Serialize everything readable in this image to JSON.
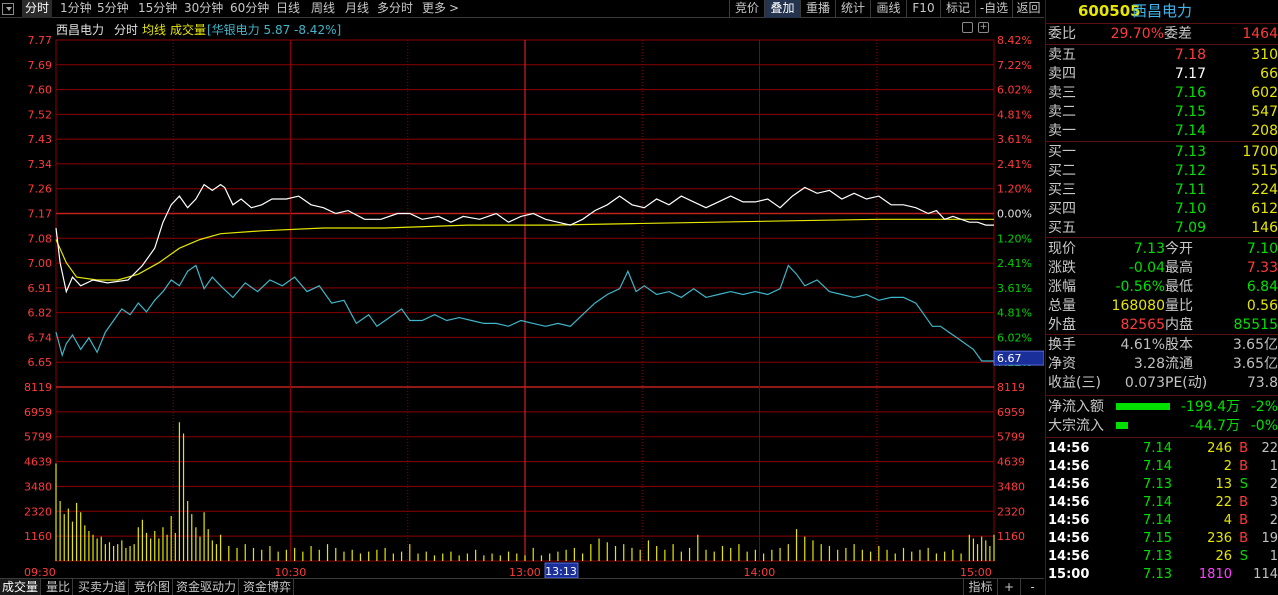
{
  "toolbar": {
    "left_items": [
      "分时",
      "1分钟",
      "5分钟",
      "15分钟",
      "30分钟",
      "60分钟",
      "日线",
      "周线",
      "月线",
      "多分时",
      "更多"
    ],
    "active": "分时",
    "right_items": [
      "竞价",
      "叠加",
      "重播",
      "统计",
      "画线",
      "F10",
      "标记",
      "-自选",
      "返回"
    ],
    "highlight": "叠加"
  },
  "chart_header": {
    "stock_name": "西昌电力",
    "label_fenshi": "分时",
    "label_junxian": "均线",
    "label_volume": "成交量",
    "overlay": "[华银电力 5.87 -8.42%]"
  },
  "price_axis": {
    "left": [
      "7.77",
      "7.69",
      "7.60",
      "7.52",
      "7.43",
      "7.34",
      "7.26",
      "7.17",
      "7.08",
      "7.00",
      "6.91",
      "6.82",
      "6.74",
      "6.65"
    ],
    "right": [
      "8.42%",
      "7.22%",
      "6.02%",
      "4.81%",
      "3.61%",
      "2.41%",
      "1.20%",
      "0.00%",
      "1.20%",
      "2.41%",
      "3.61%",
      "4.81%",
      "6.02%",
      "7.22%"
    ],
    "cursor_value": "6.67"
  },
  "volume_axis": {
    "labels": [
      "8119",
      "6959",
      "5799",
      "4639",
      "3480",
      "2320",
      "1160"
    ]
  },
  "time_axis": {
    "labels": [
      "09:30",
      "10:30",
      "13:00",
      "14:00",
      "15:00"
    ],
    "cursor_time": "13:13"
  },
  "colors": {
    "grid": "#8b0000",
    "price_line": "#ffffff",
    "avg_line": "#e6e600",
    "overlay_line": "#3fb6c9",
    "volume_bar": "#e6e600",
    "axis_text": "#ff3b3b"
  },
  "series": {
    "price": [
      [
        0,
        7.12
      ],
      [
        2,
        7.0
      ],
      [
        5,
        6.9
      ],
      [
        8,
        6.95
      ],
      [
        12,
        6.92
      ],
      [
        18,
        6.94
      ],
      [
        25,
        6.93
      ],
      [
        35,
        6.94
      ],
      [
        42,
        6.99
      ],
      [
        48,
        7.05
      ],
      [
        52,
        7.14
      ],
      [
        56,
        7.2
      ],
      [
        60,
        7.23
      ],
      [
        64,
        7.19
      ],
      [
        68,
        7.22
      ],
      [
        72,
        7.27
      ],
      [
        76,
        7.25
      ],
      [
        80,
        7.27
      ],
      [
        82,
        7.26
      ],
      [
        86,
        7.2
      ],
      [
        90,
        7.22
      ],
      [
        95,
        7.19
      ],
      [
        100,
        7.2
      ],
      [
        105,
        7.22
      ],
      [
        112,
        7.22
      ],
      [
        118,
        7.23
      ],
      [
        124,
        7.2
      ],
      [
        130,
        7.19
      ],
      [
        136,
        7.17
      ],
      [
        142,
        7.18
      ],
      [
        150,
        7.15
      ],
      [
        158,
        7.15
      ],
      [
        166,
        7.17
      ],
      [
        172,
        7.17
      ],
      [
        178,
        7.15
      ],
      [
        186,
        7.16
      ],
      [
        192,
        7.14
      ],
      [
        198,
        7.16
      ],
      [
        206,
        7.15
      ],
      [
        214,
        7.17
      ],
      [
        220,
        7.14
      ],
      [
        226,
        7.16
      ],
      [
        232,
        7.17
      ],
      [
        238,
        7.15
      ],
      [
        244,
        7.14
      ],
      [
        250,
        7.13
      ],
      [
        256,
        7.15
      ],
      [
        262,
        7.18
      ],
      [
        268,
        7.2
      ],
      [
        274,
        7.23
      ],
      [
        280,
        7.2
      ],
      [
        286,
        7.19
      ],
      [
        292,
        7.22
      ],
      [
        298,
        7.2
      ],
      [
        304,
        7.23
      ],
      [
        310,
        7.21
      ],
      [
        316,
        7.19
      ],
      [
        322,
        7.21
      ],
      [
        328,
        7.23
      ],
      [
        334,
        7.21
      ],
      [
        340,
        7.21
      ],
      [
        346,
        7.22
      ],
      [
        352,
        7.19
      ],
      [
        358,
        7.23
      ],
      [
        364,
        7.26
      ],
      [
        370,
        7.24
      ],
      [
        376,
        7.25
      ],
      [
        382,
        7.22
      ],
      [
        388,
        7.24
      ],
      [
        394,
        7.22
      ],
      [
        400,
        7.23
      ],
      [
        406,
        7.2
      ],
      [
        412,
        7.2
      ],
      [
        418,
        7.19
      ],
      [
        424,
        7.17
      ],
      [
        428,
        7.18
      ],
      [
        432,
        7.15
      ],
      [
        436,
        7.16
      ],
      [
        440,
        7.15
      ],
      [
        444,
        7.14
      ],
      [
        448,
        7.14
      ],
      [
        452,
        7.13
      ],
      [
        456,
        7.13
      ]
    ],
    "avg": [
      [
        0,
        7.08
      ],
      [
        5,
        7.0
      ],
      [
        10,
        6.95
      ],
      [
        20,
        6.94
      ],
      [
        30,
        6.94
      ],
      [
        40,
        6.96
      ],
      [
        50,
        7.0
      ],
      [
        60,
        7.05
      ],
      [
        70,
        7.08
      ],
      [
        80,
        7.1
      ],
      [
        100,
        7.11
      ],
      [
        130,
        7.12
      ],
      [
        160,
        7.12
      ],
      [
        200,
        7.13
      ],
      [
        240,
        7.13
      ],
      [
        280,
        7.135
      ],
      [
        320,
        7.14
      ],
      [
        360,
        7.145
      ],
      [
        400,
        7.15
      ],
      [
        440,
        7.15
      ],
      [
        456,
        7.15
      ]
    ],
    "overlay": [
      [
        0,
        6.76
      ],
      [
        3,
        6.68
      ],
      [
        5,
        6.72
      ],
      [
        8,
        6.75
      ],
      [
        12,
        6.7
      ],
      [
        16,
        6.74
      ],
      [
        20,
        6.69
      ],
      [
        24,
        6.76
      ],
      [
        28,
        6.8
      ],
      [
        32,
        6.84
      ],
      [
        36,
        6.82
      ],
      [
        40,
        6.86
      ],
      [
        44,
        6.83
      ],
      [
        48,
        6.87
      ],
      [
        52,
        6.9
      ],
      [
        56,
        6.94
      ],
      [
        60,
        6.92
      ],
      [
        64,
        6.97
      ],
      [
        68,
        6.99
      ],
      [
        72,
        6.91
      ],
      [
        76,
        6.95
      ],
      [
        80,
        6.92
      ],
      [
        86,
        6.88
      ],
      [
        92,
        6.93
      ],
      [
        98,
        6.9
      ],
      [
        104,
        6.94
      ],
      [
        110,
        6.92
      ],
      [
        116,
        6.95
      ],
      [
        122,
        6.9
      ],
      [
        128,
        6.92
      ],
      [
        134,
        6.86
      ],
      [
        140,
        6.87
      ],
      [
        146,
        6.79
      ],
      [
        152,
        6.82
      ],
      [
        156,
        6.78
      ],
      [
        162,
        6.81
      ],
      [
        168,
        6.84
      ],
      [
        172,
        6.8
      ],
      [
        178,
        6.8
      ],
      [
        184,
        6.82
      ],
      [
        190,
        6.8
      ],
      [
        196,
        6.81
      ],
      [
        202,
        6.8
      ],
      [
        208,
        6.79
      ],
      [
        214,
        6.79
      ],
      [
        220,
        6.78
      ],
      [
        226,
        6.8
      ],
      [
        232,
        6.79
      ],
      [
        238,
        6.78
      ],
      [
        244,
        6.79
      ],
      [
        250,
        6.78
      ],
      [
        256,
        6.82
      ],
      [
        262,
        6.86
      ],
      [
        268,
        6.89
      ],
      [
        274,
        6.91
      ],
      [
        278,
        6.97
      ],
      [
        282,
        6.9
      ],
      [
        286,
        6.92
      ],
      [
        292,
        6.89
      ],
      [
        298,
        6.9
      ],
      [
        304,
        6.88
      ],
      [
        310,
        6.91
      ],
      [
        316,
        6.88
      ],
      [
        322,
        6.89
      ],
      [
        328,
        6.9
      ],
      [
        334,
        6.89
      ],
      [
        340,
        6.9
      ],
      [
        346,
        6.89
      ],
      [
        352,
        6.91
      ],
      [
        356,
        6.99
      ],
      [
        360,
        6.96
      ],
      [
        364,
        6.92
      ],
      [
        370,
        6.94
      ],
      [
        376,
        6.9
      ],
      [
        382,
        6.89
      ],
      [
        388,
        6.88
      ],
      [
        394,
        6.89
      ],
      [
        400,
        6.87
      ],
      [
        406,
        6.88
      ],
      [
        412,
        6.88
      ],
      [
        418,
        6.86
      ],
      [
        422,
        6.82
      ],
      [
        426,
        6.78
      ],
      [
        430,
        6.78
      ],
      [
        434,
        6.76
      ],
      [
        438,
        6.74
      ],
      [
        442,
        6.72
      ],
      [
        446,
        6.7
      ],
      [
        450,
        6.66
      ],
      [
        452,
        6.66
      ],
      [
        456,
        6.66
      ]
    ],
    "volume": [
      [
        0,
        5200
      ],
      [
        2,
        3200
      ],
      [
        4,
        2500
      ],
      [
        6,
        2800
      ],
      [
        8,
        2100
      ],
      [
        10,
        3100
      ],
      [
        12,
        2600
      ],
      [
        14,
        1900
      ],
      [
        16,
        1600
      ],
      [
        18,
        1400
      ],
      [
        20,
        1200
      ],
      [
        22,
        1300
      ],
      [
        24,
        900
      ],
      [
        26,
        1000
      ],
      [
        28,
        800
      ],
      [
        30,
        900
      ],
      [
        32,
        1100
      ],
      [
        34,
        700
      ],
      [
        36,
        800
      ],
      [
        38,
        900
      ],
      [
        40,
        1800
      ],
      [
        42,
        2200
      ],
      [
        44,
        1500
      ],
      [
        46,
        1200
      ],
      [
        48,
        1600
      ],
      [
        50,
        1200
      ],
      [
        52,
        1800
      ],
      [
        54,
        1400
      ],
      [
        56,
        2400
      ],
      [
        58,
        1500
      ],
      [
        60,
        7400
      ],
      [
        62,
        6800
      ],
      [
        64,
        3200
      ],
      [
        66,
        2500
      ],
      [
        68,
        1800
      ],
      [
        70,
        1300
      ],
      [
        72,
        2600
      ],
      [
        74,
        1700
      ],
      [
        76,
        1100
      ],
      [
        78,
        900
      ],
      [
        80,
        1400
      ],
      [
        84,
        800
      ],
      [
        88,
        700
      ],
      [
        92,
        900
      ],
      [
        96,
        700
      ],
      [
        100,
        600
      ],
      [
        104,
        800
      ],
      [
        108,
        500
      ],
      [
        112,
        600
      ],
      [
        116,
        700
      ],
      [
        120,
        500
      ],
      [
        124,
        800
      ],
      [
        128,
        600
      ],
      [
        132,
        900
      ],
      [
        136,
        700
      ],
      [
        140,
        500
      ],
      [
        144,
        600
      ],
      [
        148,
        400
      ],
      [
        152,
        500
      ],
      [
        156,
        600
      ],
      [
        160,
        700
      ],
      [
        164,
        400
      ],
      [
        168,
        500
      ],
      [
        172,
        900
      ],
      [
        176,
        400
      ],
      [
        180,
        500
      ],
      [
        184,
        300
      ],
      [
        188,
        400
      ],
      [
        192,
        500
      ],
      [
        196,
        300
      ],
      [
        200,
        400
      ],
      [
        204,
        600
      ],
      [
        208,
        300
      ],
      [
        212,
        400
      ],
      [
        216,
        300
      ],
      [
        220,
        500
      ],
      [
        224,
        400
      ],
      [
        228,
        300
      ],
      [
        232,
        700
      ],
      [
        236,
        300
      ],
      [
        240,
        400
      ],
      [
        244,
        500
      ],
      [
        248,
        600
      ],
      [
        252,
        700
      ],
      [
        256,
        400
      ],
      [
        260,
        900
      ],
      [
        264,
        1200
      ],
      [
        268,
        1000
      ],
      [
        272,
        800
      ],
      [
        276,
        900
      ],
      [
        280,
        700
      ],
      [
        284,
        600
      ],
      [
        288,
        1100
      ],
      [
        292,
        800
      ],
      [
        296,
        600
      ],
      [
        300,
        900
      ],
      [
        304,
        500
      ],
      [
        308,
        700
      ],
      [
        312,
        1400
      ],
      [
        316,
        600
      ],
      [
        320,
        500
      ],
      [
        324,
        800
      ],
      [
        328,
        700
      ],
      [
        332,
        900
      ],
      [
        336,
        500
      ],
      [
        340,
        600
      ],
      [
        344,
        400
      ],
      [
        348,
        600
      ],
      [
        352,
        700
      ],
      [
        356,
        900
      ],
      [
        360,
        1700
      ],
      [
        364,
        1300
      ],
      [
        368,
        1100
      ],
      [
        372,
        900
      ],
      [
        376,
        800
      ],
      [
        380,
        600
      ],
      [
        384,
        700
      ],
      [
        388,
        900
      ],
      [
        392,
        600
      ],
      [
        396,
        500
      ],
      [
        400,
        800
      ],
      [
        404,
        600
      ],
      [
        408,
        400
      ],
      [
        412,
        700
      ],
      [
        416,
        500
      ],
      [
        420,
        600
      ],
      [
        424,
        700
      ],
      [
        428,
        400
      ],
      [
        432,
        500
      ],
      [
        436,
        600
      ],
      [
        440,
        400
      ],
      [
        444,
        1400
      ],
      [
        446,
        1200
      ],
      [
        448,
        900
      ],
      [
        450,
        1300
      ],
      [
        452,
        1100
      ],
      [
        454,
        800
      ],
      [
        456,
        1400
      ]
    ]
  },
  "panel": {
    "code": "600505",
    "name": "西昌电力",
    "weibi_label": "委比",
    "weibi_value": "29.70%",
    "weicha_label": "委差",
    "weicha_value": "1464",
    "sells": [
      {
        "label": "卖五",
        "price": "7.18",
        "vol": "310",
        "pc": "red"
      },
      {
        "label": "卖四",
        "price": "7.17",
        "vol": "66",
        "pc": "white"
      },
      {
        "label": "卖三",
        "price": "7.16",
        "vol": "602",
        "pc": "green"
      },
      {
        "label": "卖二",
        "price": "7.15",
        "vol": "547",
        "pc": "green"
      },
      {
        "label": "卖一",
        "price": "7.14",
        "vol": "208",
        "pc": "green"
      }
    ],
    "buys": [
      {
        "label": "买一",
        "price": "7.13",
        "vol": "1700",
        "pc": "green"
      },
      {
        "label": "买二",
        "price": "7.12",
        "vol": "515",
        "pc": "green"
      },
      {
        "label": "买三",
        "price": "7.11",
        "vol": "224",
        "pc": "green"
      },
      {
        "label": "买四",
        "price": "7.10",
        "vol": "612",
        "pc": "green"
      },
      {
        "label": "买五",
        "price": "7.09",
        "vol": "146",
        "pc": "green"
      }
    ],
    "stats": [
      {
        "l1": "现价",
        "v1": "7.13",
        "c1": "green",
        "l2": "今开",
        "v2": "7.10",
        "c2": "green"
      },
      {
        "l1": "涨跌",
        "v1": "-0.04",
        "c1": "green",
        "l2": "最高",
        "v2": "7.33",
        "c2": "red"
      },
      {
        "l1": "涨幅",
        "v1": "-0.56%",
        "c1": "green",
        "l2": "最低",
        "v2": "6.84",
        "c2": "green"
      },
      {
        "l1": "总量",
        "v1": "168080",
        "c1": "yellow",
        "l2": "量比",
        "v2": "0.56",
        "c2": "yellow"
      },
      {
        "l1": "外盘",
        "v1": "82565",
        "c1": "red",
        "l2": "内盘",
        "v2": "85515",
        "c2": "green"
      }
    ],
    "stats2": [
      {
        "l1": "换手",
        "v1": "4.61%",
        "l2": "股本",
        "v2": "3.65亿"
      },
      {
        "l1": "净资",
        "v1": "3.28",
        "l2": "流通",
        "v2": "3.65亿"
      },
      {
        "l1": "收益(三)",
        "v1": "0.073",
        "l2": "PE(动)",
        "v2": "73.8"
      }
    ],
    "flows": [
      {
        "label": "净流入额",
        "value": "-199.4万",
        "pct": "-2%",
        "bar": 1
      },
      {
        "label": "大宗流入",
        "value": "-44.7万",
        "pct": "-0%",
        "bar": 0.22
      }
    ],
    "ticks": [
      {
        "time": "14:56",
        "price": "7.14",
        "vol": "246",
        "bs": "B",
        "n": "22",
        "vc": "yellow"
      },
      {
        "time": "14:56",
        "price": "7.14",
        "vol": "2",
        "bs": "B",
        "n": "1",
        "vc": "yellow"
      },
      {
        "time": "14:56",
        "price": "7.13",
        "vol": "13",
        "bs": "S",
        "n": "2",
        "vc": "yellow"
      },
      {
        "time": "14:56",
        "price": "7.14",
        "vol": "22",
        "bs": "B",
        "n": "3",
        "vc": "yellow"
      },
      {
        "time": "14:56",
        "price": "7.14",
        "vol": "4",
        "bs": "B",
        "n": "2",
        "vc": "yellow"
      },
      {
        "time": "14:56",
        "price": "7.15",
        "vol": "236",
        "bs": "B",
        "n": "19",
        "vc": "yellow"
      },
      {
        "time": "14:56",
        "price": "7.13",
        "vol": "26",
        "bs": "S",
        "n": "1",
        "vc": "yellow"
      },
      {
        "time": "15:00",
        "price": "7.13",
        "vol": "1810",
        "bs": "",
        "n": "114",
        "vc": "magenta"
      }
    ]
  },
  "bottom_tabs": {
    "items": [
      "成交量",
      "量比",
      "买卖力道",
      "竞价图",
      "资金驱动力",
      "资金博弈"
    ],
    "active": "成交量",
    "right_items": [
      "指标",
      "+",
      "-"
    ]
  }
}
